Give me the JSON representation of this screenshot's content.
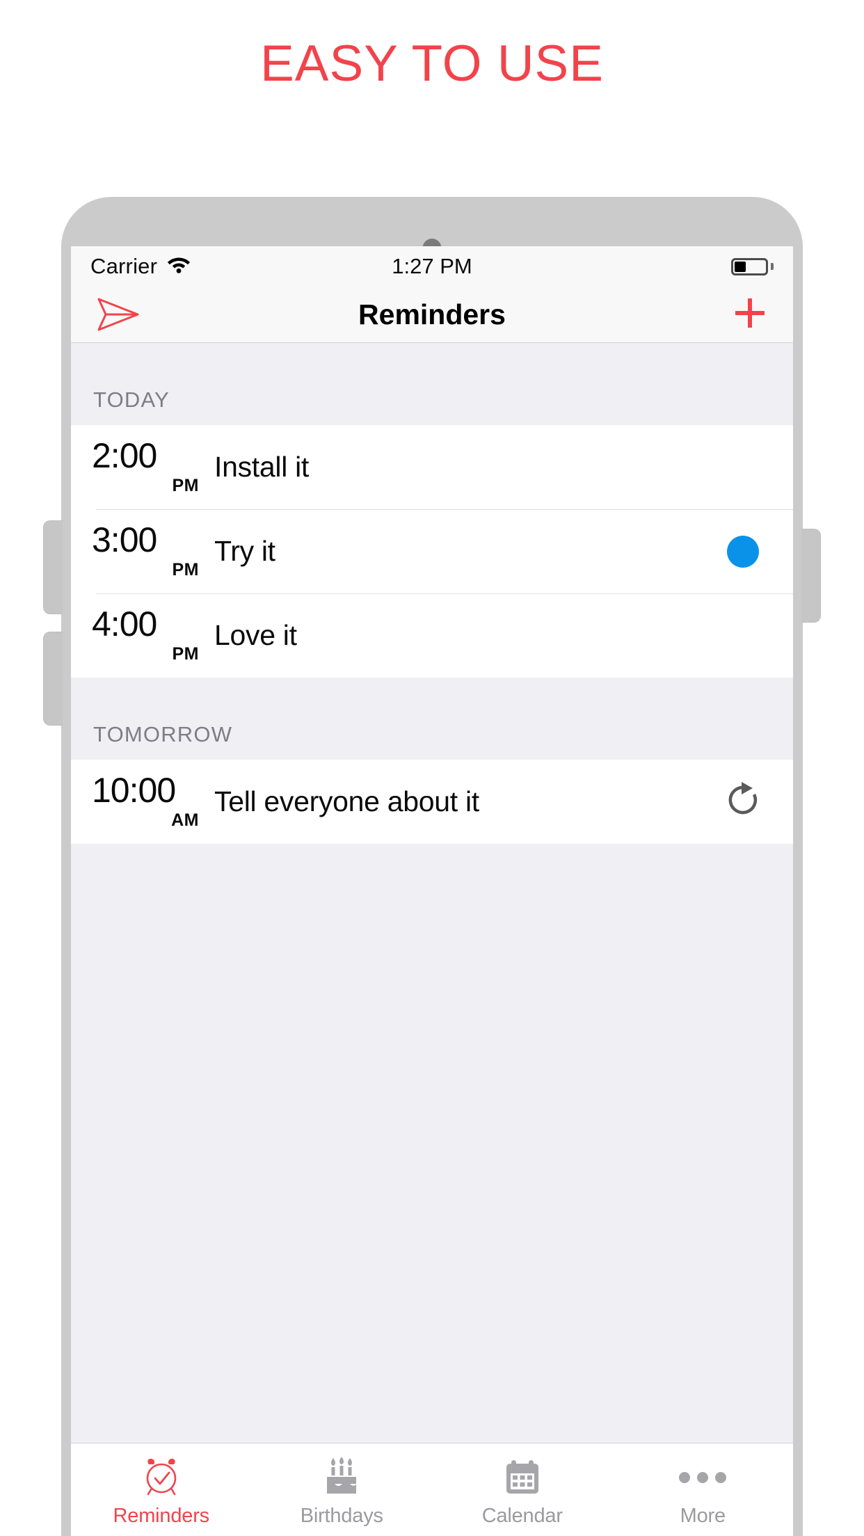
{
  "headline": "EASY TO USE",
  "colors": {
    "accent_red": "#F2434B",
    "blue_dot": "#0A92E8",
    "gray_text": "#9A9A9F",
    "screen_bg": "#EFEFF4"
  },
  "status_bar": {
    "carrier": "Carrier",
    "wifi_icon": "wifi-icon",
    "time": "1:27 PM",
    "battery_icon": "battery-icon",
    "battery_level_percent": 35
  },
  "nav_bar": {
    "left_icon": "send-paper-plane-icon",
    "title": "Reminders",
    "right_icon": "plus-icon"
  },
  "sections": [
    {
      "header": "TODAY",
      "rows": [
        {
          "time": "2:00",
          "ampm": "PM",
          "title": "Install it",
          "accessory": "none"
        },
        {
          "time": "3:00",
          "ampm": "PM",
          "title": "Try it",
          "accessory": "blue-dot"
        },
        {
          "time": "4:00",
          "ampm": "PM",
          "title": "Love it",
          "accessory": "none"
        }
      ]
    },
    {
      "header": "TOMORROW",
      "rows": [
        {
          "time": "10:00",
          "ampm": "AM",
          "title": "Tell everyone about it",
          "accessory": "repeat-icon"
        }
      ]
    }
  ],
  "tab_bar": {
    "tabs": [
      {
        "label": "Reminders",
        "icon": "alarm-clock-check-icon",
        "active": true
      },
      {
        "label": "Birthdays",
        "icon": "birthday-cake-icon",
        "active": false
      },
      {
        "label": "Calendar",
        "icon": "calendar-icon",
        "active": false
      },
      {
        "label": "More",
        "icon": "ellipsis-icon",
        "active": false
      }
    ]
  }
}
